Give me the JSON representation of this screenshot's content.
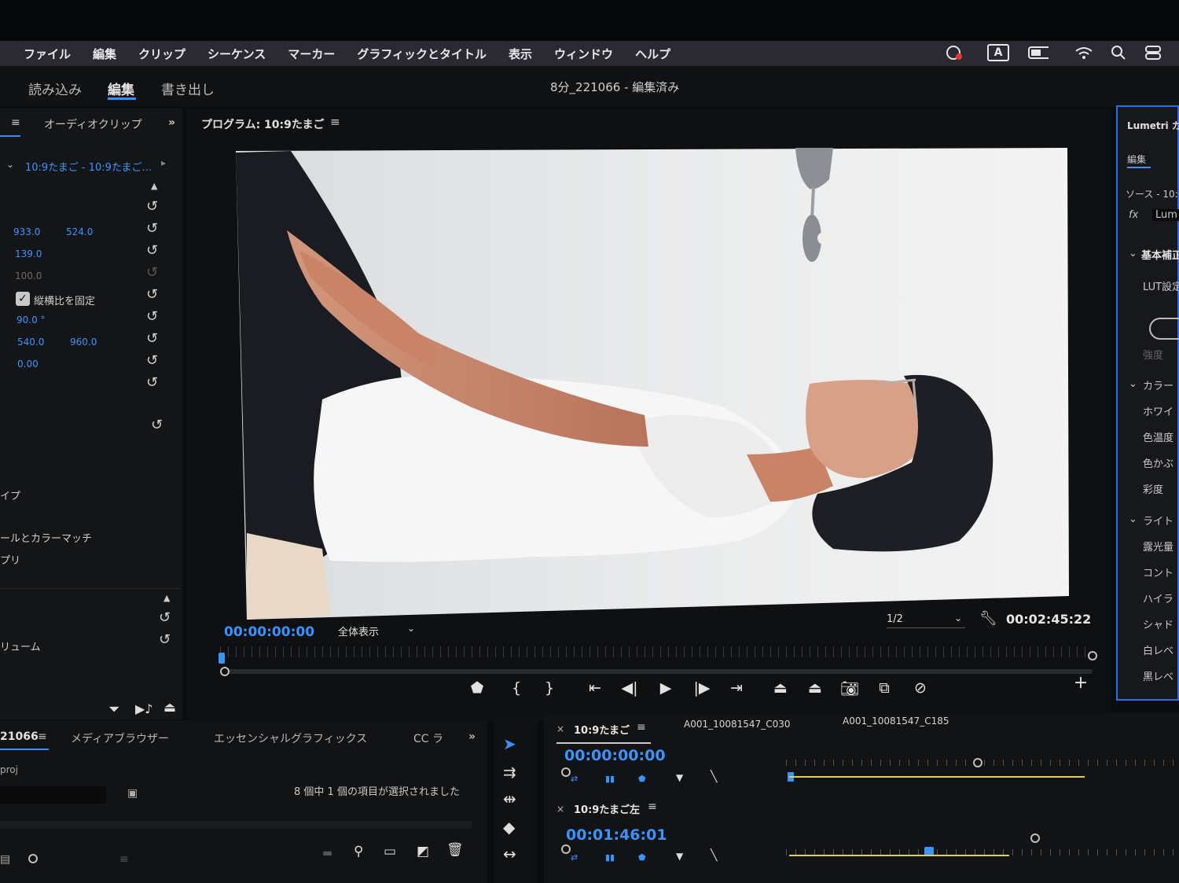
{
  "menubar": {
    "items": [
      "ファイル",
      "編集",
      "クリップ",
      "シーケンス",
      "マーカー",
      "グラフィックとタイトル",
      "表示",
      "ウィンドウ",
      "ヘルプ"
    ],
    "status_icons": [
      "creative-cloud-icon",
      "input-method-icon",
      "battery-icon",
      "wifi-icon",
      "spotlight-search-icon",
      "control-center-icon"
    ],
    "input_method_label": "A"
  },
  "workspace": {
    "tabs": [
      "読み込み",
      "編集",
      "書き出し"
    ],
    "active_tab": "編集",
    "document_title": "8分_221066 - 編集済み"
  },
  "effect_controls": {
    "tab_label": "オーディオクリップ",
    "clip_selector": "10:9たまご - 10:9たまご...",
    "position_x": "933.0",
    "position_y": "524.0",
    "scale": "139.0",
    "scale_width": "100.0",
    "uniform_scale_label": "縦横比を固定",
    "uniform_scale_checked": true,
    "rotation": "90.0 °",
    "anchor_x": "540.0",
    "anchor_y": "960.0",
    "anti_flicker": "0.00",
    "partial_label_1": "イプ",
    "partial_label_2": "ールとカラーマッチ",
    "partial_label_3": "プリ",
    "partial_label_4": "リューム"
  },
  "program_monitor": {
    "title": "プログラム: 10:9たまご",
    "timecode_current": "00:00:00:00",
    "zoom_select": "全体表示",
    "resolution_select": "1/2",
    "timecode_duration": "00:02:45:22"
  },
  "lumetri": {
    "panel_title": "Lumetri カ",
    "tab_edit": "編集",
    "source_label": "ソース - 10:9",
    "fx_label": "fx",
    "fx_name": "Lum",
    "section_basic": "基本補正",
    "lut_label": "LUT設定",
    "intensity_label": "強度",
    "section_color": "カラー",
    "white_balance": "ホワイ",
    "temperature": "色温度",
    "tint": "色かぶ",
    "saturation": "彩度",
    "section_light": "ライト",
    "exposure": "露光量",
    "contrast": "コント",
    "highlights": "ハイラ",
    "shadows": "シャド",
    "whites": "白レベ",
    "blacks": "黒レベ"
  },
  "project_panel": {
    "tab_project": "21066",
    "tab_media_browser": "メディアブラウザー",
    "tab_essential_graphics": "エッセンシャルグラフィックス",
    "tab_cc_libraries": "CC ラ",
    "project_file": "proj",
    "selection_status": "8 個中 1 個の項目が選択されました"
  },
  "timeline": {
    "sequences": [
      {
        "name": "10:9たまご",
        "timecode": "00:00:00:00",
        "clips": [
          "A001_10081547_C030",
          "A001_10081547_C185"
        ]
      },
      {
        "name": "10:9たまご左",
        "timecode": "00:01:46:01",
        "clips": []
      }
    ]
  },
  "colors": {
    "accent_blue": "#3b93ff",
    "selection_border": "#2c6cf0",
    "menubar_bg": "#2b2a33",
    "panel_bg": "#141517",
    "playhead_yellow": "#e3cf3a"
  }
}
